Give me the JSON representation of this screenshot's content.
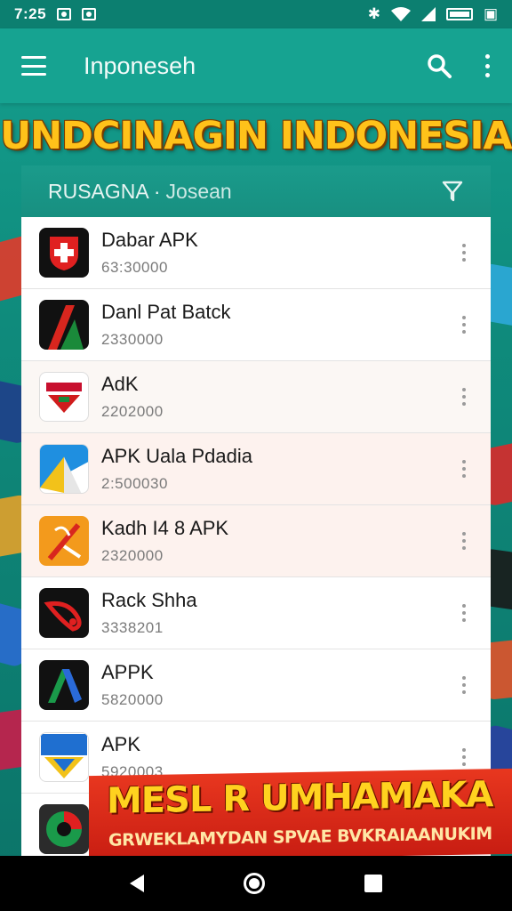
{
  "status_bar": {
    "time": "7:25",
    "icons": [
      "photo-icon",
      "gallery-icon",
      "bluetooth-icon",
      "wifi-icon",
      "signal-icon",
      "battery-icon",
      "notification-icon"
    ]
  },
  "app_bar": {
    "title": "Inponeseh",
    "icons": [
      "menu-icon",
      "search-icon",
      "more-vert-icon"
    ]
  },
  "banner": {
    "title": "UNDCINAGIN INDONESIA"
  },
  "panel": {
    "header_title": "RUSAGNA ·",
    "header_subtitle": "Josean",
    "header_icon": "filter-icon"
  },
  "apps": [
    {
      "name": "Dabar APK",
      "size": "63:30000",
      "icon": "red-cross-icon",
      "bg": "#111111"
    },
    {
      "name": "Danl Pat Batck",
      "size": "2330000",
      "icon": "red-green-stripe-icon",
      "bg": "#111111"
    },
    {
      "name": "AdK",
      "size": "2202000",
      "icon": "red-shield-icon",
      "bg": "#ffffff"
    },
    {
      "name": "APK Uala Pdadia",
      "size": "2:500030",
      "icon": "blue-flag-icon",
      "bg": "#ffffff"
    },
    {
      "name": "Kadh I4 8 APK",
      "size": "2320000",
      "icon": "orange-leaf-icon",
      "bg": "#f39a1c"
    },
    {
      "name": "Rack Shha",
      "size": "3338201",
      "icon": "red-rocket-icon",
      "bg": "#111111"
    },
    {
      "name": "APPK",
      "size": "5820000",
      "icon": "blue-green-a-icon",
      "bg": "#111111"
    },
    {
      "name": "APK",
      "size": "5920003",
      "icon": "yellow-blue-shield-icon",
      "bg": "#ffffff"
    },
    {
      "name": "",
      "size": "",
      "icon": "green-globe-icon",
      "bg": "#2b2b2b"
    }
  ],
  "promo": {
    "title": "MESL R UMHAMAKA",
    "subtitle": "GRWEKLAMYDAN SPVAE BVKRAIAANUKIM"
  },
  "nav_bar": {
    "icons": [
      "back-icon",
      "home-icon",
      "recents-icon"
    ]
  },
  "colors": {
    "app_bar": "#16a391",
    "status_bar": "#0c7f70",
    "banner_title": "#ffc21a",
    "promo_bg": "#d8281a"
  }
}
